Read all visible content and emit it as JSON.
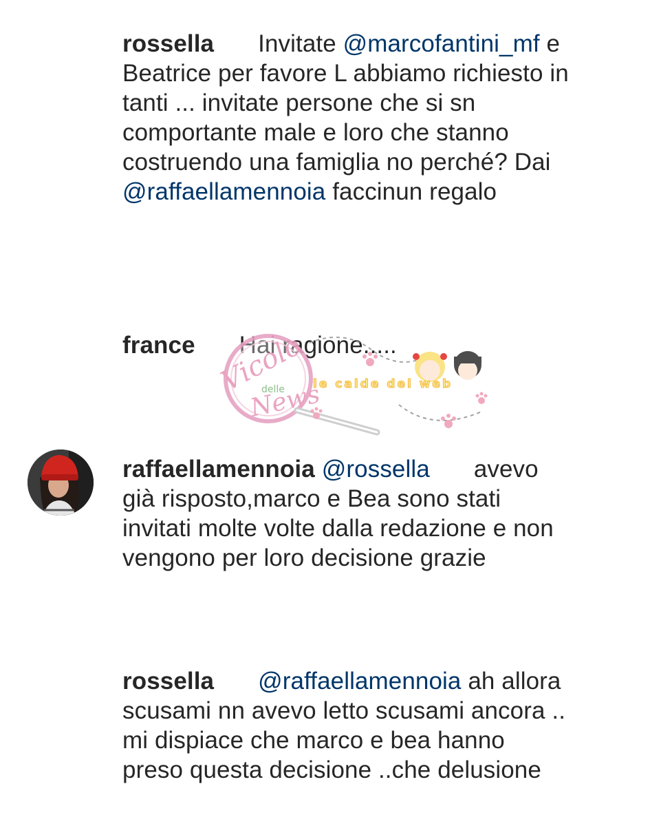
{
  "comments": [
    {
      "username": "rossella",
      "parts": [
        {
          "t": "Invitate ",
          "mention": false
        },
        {
          "t": "@marcofantini_mf",
          "mention": true
        },
        {
          "t": " e Beatrice per favore L abbiamo richiesto in tanti ... invitate persone che si sn comportante male e loro che stanno costruendo una famiglia no perché? Dai ",
          "mention": false
        },
        {
          "t": "@raffaellamennoia",
          "mention": true
        },
        {
          "t": " faccinun regalo",
          "mention": false
        }
      ]
    },
    {
      "username": "france",
      "parts": [
        {
          "t": "Hai ragione.....",
          "mention": false
        }
      ]
    },
    {
      "username": "raffaellamennoia",
      "parts": [
        {
          "t": "@rossella",
          "mention": true
        },
        {
          "t": " avevo già risposto,marco e Bea sono stati invitati molte volte dalla redazione e non vengono per loro decisione grazie",
          "mention": false
        }
      ]
    },
    {
      "username": "rossella",
      "parts": [
        {
          "t": "@raffaellamennoia",
          "mention": true
        },
        {
          "t": " ah allora scusami nn avevo letto scusami ancora .. mi dispiace che marco e bea hanno preso questa decisione ..che delusione",
          "mention": false
        }
      ]
    }
  ],
  "watermark": {
    "logo_line1": "Vicolo",
    "logo_line2": "delle",
    "logo_line3": "News",
    "subtitle": "le calde del web"
  },
  "colors": {
    "text": "#262626",
    "mention": "#003569",
    "watermark_pink": "#e79bbb",
    "watermark_yellow": "#fbe98a"
  },
  "icons": {
    "avatar": "user-avatar-red-hat"
  }
}
